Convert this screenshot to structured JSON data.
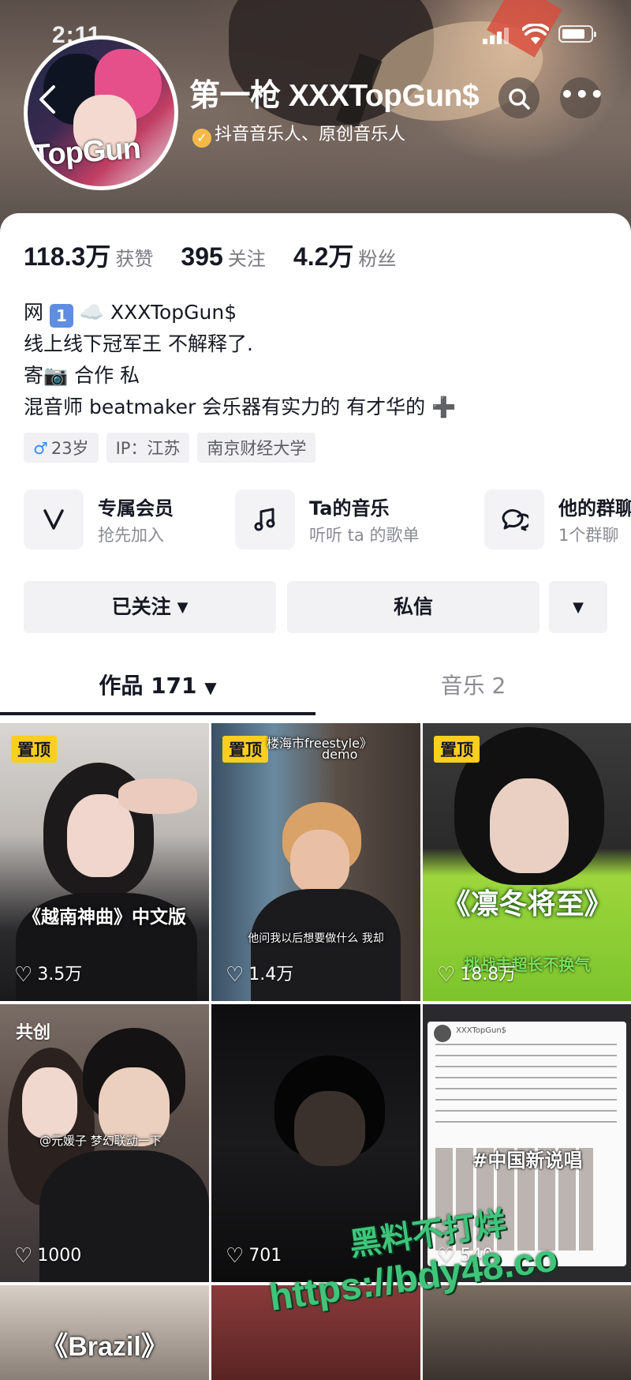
{
  "status_bar": {
    "time": "2:11"
  },
  "profile": {
    "name": "第一枪 XXXTopGun$",
    "verification": "抖音音乐人、原创音乐人",
    "avatar_text": "TopGun"
  },
  "stats": [
    {
      "value": "118.3万",
      "label": "获赞"
    },
    {
      "value": "395",
      "label": "关注"
    },
    {
      "value": "4.2万",
      "label": "粉丝"
    }
  ],
  "bio": {
    "line1_prefix": "网",
    "line1_badge": "1",
    "line1_cloud": "☁️",
    "line1_suffix": "XXXTopGun$",
    "line2": "线上线下冠军王 不解释了.",
    "line3_prefix": "寄",
    "line3_camera": "📷",
    "line3_suffix": "合作 私",
    "line4": "混音师 beatmaker  会乐器有实力的 有才华的 ➕"
  },
  "tags": {
    "age": "23岁",
    "ip": "IP：江苏",
    "school": "南京财经大学"
  },
  "features": [
    {
      "title": "专属会员",
      "sub": "抢先加入",
      "icon": "v-icon"
    },
    {
      "title": "Ta的音乐",
      "sub": "听听 ta 的歌单",
      "icon": "music-note-icon"
    },
    {
      "title": "他的群聊",
      "sub": "1个群聊",
      "icon": "chat-icon"
    }
  ],
  "actions": {
    "follow": "已关注",
    "message": "私信"
  },
  "tabs": {
    "works": "作品 171",
    "music": "音乐 2"
  },
  "videos": [
    {
      "badge": "置顶",
      "likes": "3.5万",
      "caption": "《越南神曲》中文版"
    },
    {
      "badge": "置顶",
      "likes": "1.4万",
      "caption_top": "楼海市freestyle》",
      "caption_top2": "demo",
      "caption": "他问我以后想要做什么 我却"
    },
    {
      "badge": "置顶",
      "likes": "18.8万",
      "caption": "《凛冬将至》",
      "caption2": "挑战击超长不换气"
    },
    {
      "badge": "共创",
      "likes": "1000",
      "caption": "@元媛子 梦幻联动一下"
    },
    {
      "badge": "",
      "likes": "701",
      "caption": ""
    },
    {
      "badge": "",
      "likes": "540",
      "caption": "#中国新说唱",
      "post_author": "XXXTopGun$"
    },
    {
      "caption": "《Brazil》"
    }
  ],
  "watermark": {
    "line1": "黑料不打烊",
    "line2": "https://bdy48.co"
  },
  "colors": {
    "accent_pin": "#fccf1e",
    "text_primary": "#161823",
    "text_secondary": "#8a8b91",
    "verify_badge": "#f5b94a"
  }
}
